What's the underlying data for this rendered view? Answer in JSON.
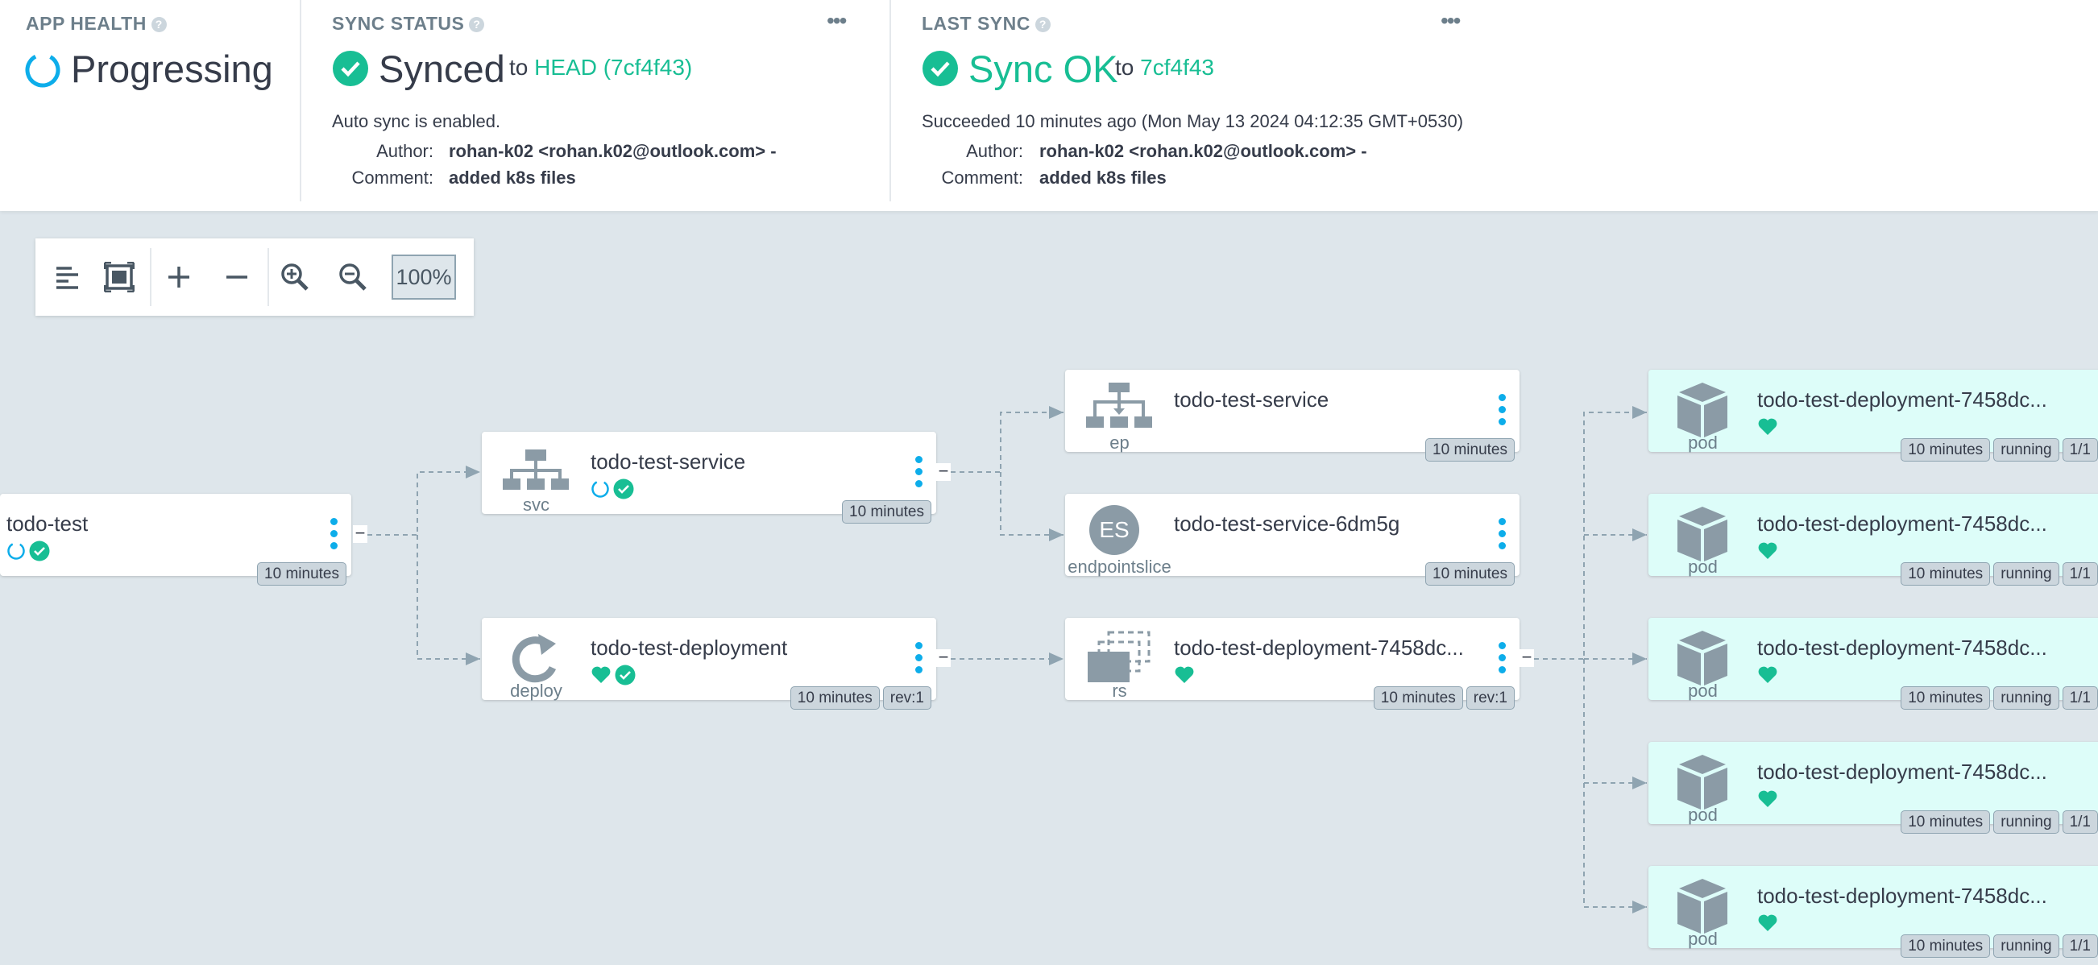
{
  "app_health": {
    "title": "APP HEALTH",
    "help": "?",
    "status": "Progressing"
  },
  "sync_status": {
    "title": "SYNC STATUS",
    "help": "?",
    "more": "•••",
    "status": "Synced",
    "to_label": "to",
    "revision": "HEAD (7cf4f43)",
    "auto_sync": "Auto sync is enabled.",
    "author_label": "Author:",
    "author_value": "rohan-k02 <rohan.k02@outlook.com> -",
    "comment_label": "Comment:",
    "comment_value": "added k8s files"
  },
  "last_sync": {
    "title": "LAST SYNC",
    "help": "?",
    "more": "•••",
    "status": "Sync OK",
    "to_label": "to",
    "revision": "7cf4f43",
    "succeeded": "Succeeded 10 minutes ago (Mon May 13 2024 04:12:35 GMT+0530)",
    "author_label": "Author:",
    "author_value": "rohan-k02 <rohan.k02@outlook.com> -",
    "comment_label": "Comment:",
    "comment_value": "added k8s files"
  },
  "toolbar": {
    "zoom": "100%",
    "icons": [
      "align-left-icon",
      "fit-screen-icon",
      "expand-plus-icon",
      "collapse-minus-icon",
      "zoom-in-icon",
      "zoom-out-icon"
    ]
  },
  "colors": {
    "green": "#18be94",
    "blue": "#0dadea",
    "icon_gray": "#8b9ba6",
    "pod_bg": "#ddfdf9",
    "canvas": "#dee6eb"
  },
  "nodes": {
    "root": {
      "name": "todo-test",
      "age": "10 minutes",
      "collapse": "−"
    },
    "svc": {
      "kind": "svc",
      "name": "todo-test-service",
      "age": "10 minutes",
      "collapse": "−"
    },
    "deploy": {
      "kind": "deploy",
      "name": "todo-test-deployment",
      "age": "10 minutes",
      "rev": "rev:1",
      "collapse": "−"
    },
    "ep": {
      "kind": "ep",
      "name": "todo-test-service",
      "age": "10 minutes"
    },
    "es": {
      "kind": "endpointslice",
      "icon_text": "ES",
      "name": "todo-test-service-6dm5g",
      "age": "10 minutes"
    },
    "rs": {
      "kind": "rs",
      "name": "todo-test-deployment-7458dc...",
      "age": "10 minutes",
      "rev": "rev:1",
      "collapse": "−"
    },
    "pods": [
      {
        "kind": "pod",
        "name": "todo-test-deployment-7458dc...",
        "age": "10 minutes",
        "state": "running",
        "ready": "1/1"
      },
      {
        "kind": "pod",
        "name": "todo-test-deployment-7458dc...",
        "age": "10 minutes",
        "state": "running",
        "ready": "1/1"
      },
      {
        "kind": "pod",
        "name": "todo-test-deployment-7458dc...",
        "age": "10 minutes",
        "state": "running",
        "ready": "1/1"
      },
      {
        "kind": "pod",
        "name": "todo-test-deployment-7458dc...",
        "age": "10 minutes",
        "state": "running",
        "ready": "1/1"
      },
      {
        "kind": "pod",
        "name": "todo-test-deployment-7458dc...",
        "age": "10 minutes",
        "state": "running",
        "ready": "1/1"
      }
    ]
  }
}
